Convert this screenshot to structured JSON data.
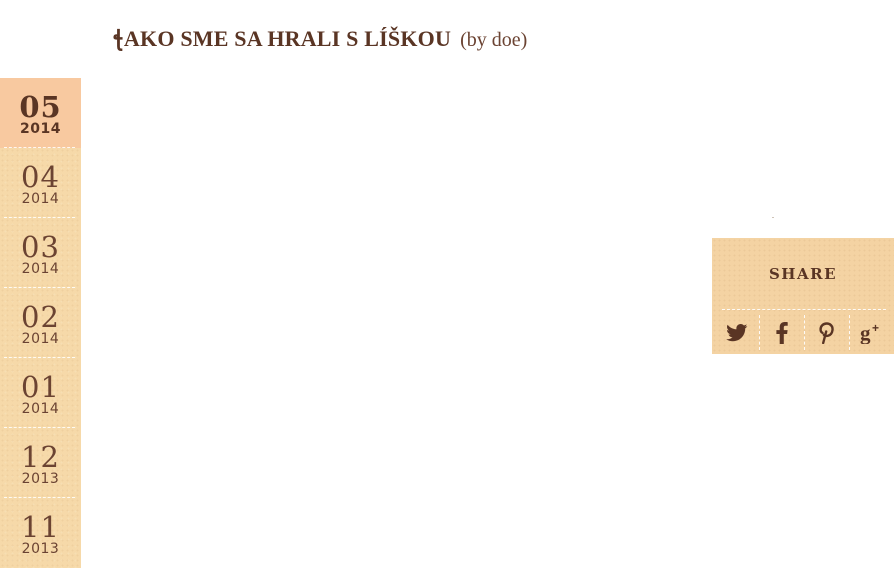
{
  "post": {
    "title": "ꞎAKO SME SA HRALI S LÍŠKOU",
    "author_note": "(by doe)"
  },
  "archive": [
    {
      "month": "05",
      "year": "2014",
      "active": true
    },
    {
      "month": "04",
      "year": "2014",
      "active": false
    },
    {
      "month": "03",
      "year": "2014",
      "active": false
    },
    {
      "month": "02",
      "year": "2014",
      "active": false
    },
    {
      "month": "01",
      "year": "2014",
      "active": false
    },
    {
      "month": "12",
      "year": "2013",
      "active": false
    },
    {
      "month": "11",
      "year": "2013",
      "active": false
    }
  ],
  "share": {
    "label": "SHARE",
    "icons": [
      "twitter-icon",
      "facebook-icon",
      "pinterest-icon",
      "google-plus-icon"
    ]
  },
  "colors": {
    "text_brown": "#5a3524",
    "sidebar_bg": "#f6d9a9",
    "sidebar_active_bg": "#f8c9a0",
    "share_bg": "#f4d3a3"
  }
}
